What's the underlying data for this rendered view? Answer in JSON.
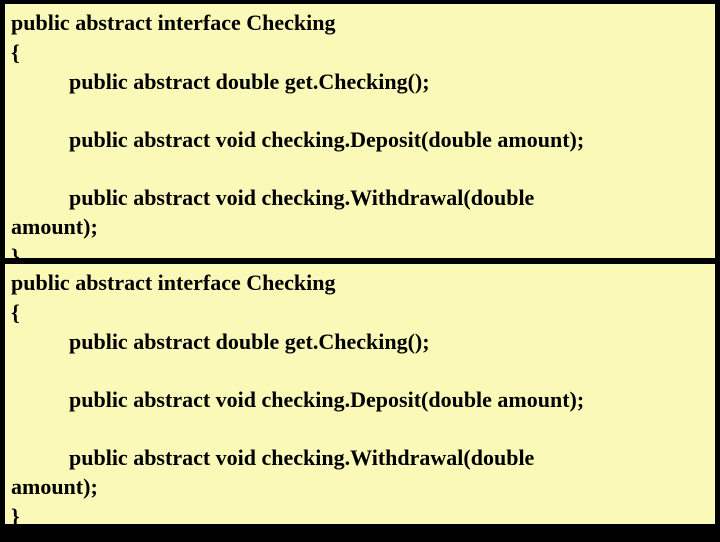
{
  "block1": {
    "sig": "public abstract interface Checking",
    "open": "{",
    "m1": "public abstract double get.Checking();",
    "m2": "public abstract void checking.Deposit(double amount);",
    "m3a": "public abstract void checking.Withdrawal(double",
    "m3b": "amount);",
    "close": "}"
  },
  "block2": {
    "sig": "public abstract interface Checking",
    "open": "{",
    "m1": "public abstract double get.Checking();",
    "m2": "public abstract void checking.Deposit(double amount);",
    "m3a": "public abstract void checking.Withdrawal(double",
    "m3b": "amount);",
    "close": "}"
  }
}
